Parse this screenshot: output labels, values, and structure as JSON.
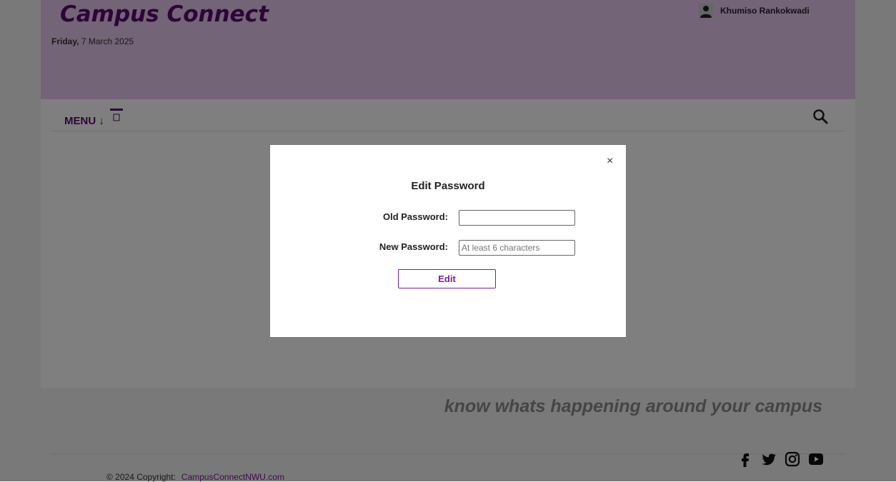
{
  "header": {
    "brand": "Campus Connect",
    "date_weekday": "Friday,",
    "date_rest": "7 March 2025",
    "user_name": "Khumiso Rankokwadi"
  },
  "nav": {
    "menu_label": "MENU ↓"
  },
  "modal": {
    "title": "Edit Password",
    "old_password_label": "Old Password:",
    "old_password_value": "",
    "new_password_label": "New Password:",
    "new_password_placeholder": "At least 6 characters",
    "edit_button": "Edit",
    "close_symbol": "×"
  },
  "footer": {
    "tagline": "know whats happening around your campus",
    "copyright": "© 2024 Copyright:",
    "link": "CampusConnectNWU.com"
  },
  "colors": {
    "brand": "#5a0a6e",
    "header_bg": "#e6c9ee",
    "accent": "#7a1a9a"
  },
  "icons": [
    "user-icon",
    "menu-icon",
    "search-icon",
    "close-icon",
    "facebook-icon",
    "twitter-icon",
    "instagram-icon",
    "youtube-icon"
  ]
}
